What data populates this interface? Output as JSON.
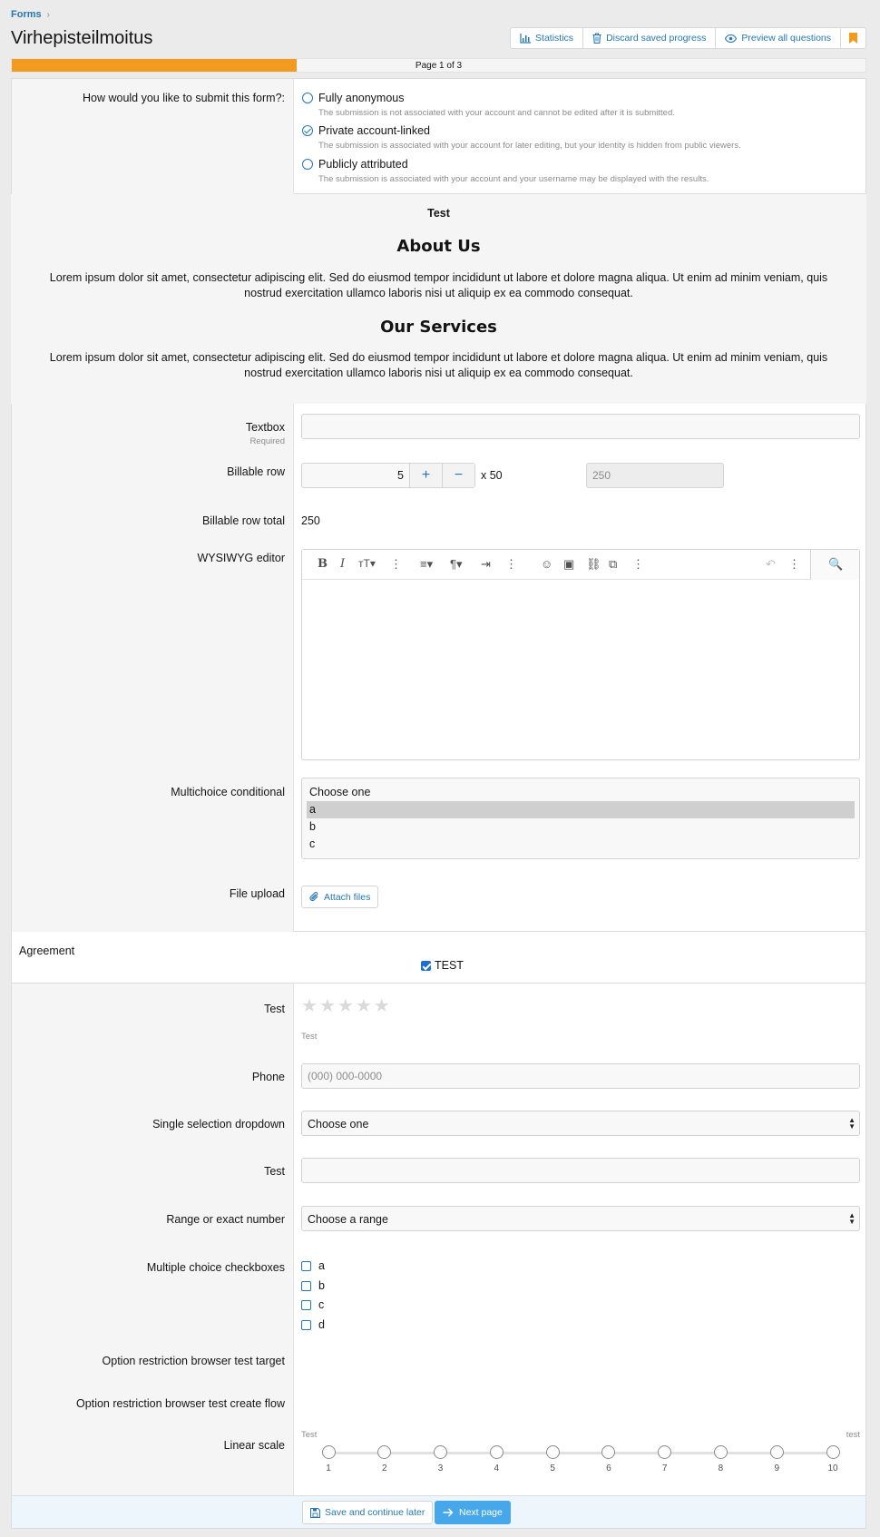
{
  "breadcrumb": {
    "item": "Forms",
    "separator": "›"
  },
  "page_title": "Virhepisteilmoitus",
  "top_buttons": {
    "statistics": "Statistics",
    "discard": "Discard saved progress",
    "preview": "Preview all questions"
  },
  "progress": {
    "label": "Page 1 of 3",
    "fraction": 0.3333
  },
  "submit_mode": {
    "label": "How would you like to submit this form?:",
    "options": [
      {
        "title": "Fully anonymous",
        "desc": "The submission is not associated with your account and cannot be edited after it is submitted.",
        "checked": false
      },
      {
        "title": "Private account-linked",
        "desc": "The submission is associated with your account for later editing, but your identity is hidden from public viewers.",
        "checked": true
      },
      {
        "title": "Publicly attributed",
        "desc": "The submission is associated with your account and your username may be displayed with the results.",
        "checked": false
      }
    ]
  },
  "info": {
    "small_title": "Test",
    "heading1": "About Us",
    "para1": "Lorem ipsum dolor sit amet, consectetur adipiscing elit. Sed do eiusmod tempor incididunt ut labore et dolore magna aliqua. Ut enim ad minim veniam, quis nostrud exercitation ullamco laboris nisi ut aliquip ex ea commodo consequat.",
    "heading2": "Our Services",
    "para2": "Lorem ipsum dolor sit amet, consectetur adipiscing elit. Sed do eiusmod tempor incididunt ut labore et dolore magna aliqua. Ut enim ad minim veniam, quis nostrud exercitation ullamco laboris nisi ut aliquip ex ea commodo consequat."
  },
  "textbox": {
    "label": "Textbox",
    "hint": "Required",
    "value": ""
  },
  "billable": {
    "label": "Billable row",
    "quantity": "5",
    "plus": "+",
    "minus": "−",
    "multiplier": "x 50",
    "result": "250"
  },
  "billable_total": {
    "label": "Billable row total",
    "value": "250"
  },
  "wysiwyg": {
    "label": "WYSIWYG editor"
  },
  "multichoice": {
    "label": "Multichoice conditional",
    "options": [
      "Choose one",
      "a",
      "b",
      "c"
    ],
    "selected": "a"
  },
  "file_upload": {
    "label": "File upload",
    "button": "Attach files"
  },
  "agreement": {
    "label": "Agreement",
    "checkbox_label": "TEST",
    "checked": true
  },
  "rating": {
    "label": "Test",
    "stars": 5,
    "value": 0,
    "caption": "Test"
  },
  "phone": {
    "label": "Phone",
    "placeholder": "(000) 000-0000"
  },
  "single_dropdown": {
    "label": "Single selection dropdown",
    "value": "Choose one"
  },
  "test_input": {
    "label": "Test",
    "value": ""
  },
  "range": {
    "label": "Range or exact number",
    "value": "Choose a range"
  },
  "checkboxes": {
    "label": "Multiple choice checkboxes",
    "options": [
      "a",
      "b",
      "c",
      "d"
    ]
  },
  "restriction_target": {
    "label": "Option restriction browser test target"
  },
  "restriction_flow": {
    "label": "Option restriction browser test create flow"
  },
  "linear_scale": {
    "label": "Linear scale",
    "min_label": "Test",
    "max_label": "test",
    "points": [
      "1",
      "2",
      "3",
      "4",
      "5",
      "6",
      "7",
      "8",
      "9",
      "10"
    ]
  },
  "footer": {
    "save": "Save and continue later",
    "next": "Next page"
  },
  "colors": {
    "accent": "#2577b1",
    "progress": "#f29b1e",
    "primary_button": "#47a7eb",
    "bookmark": "#f29b1e"
  }
}
